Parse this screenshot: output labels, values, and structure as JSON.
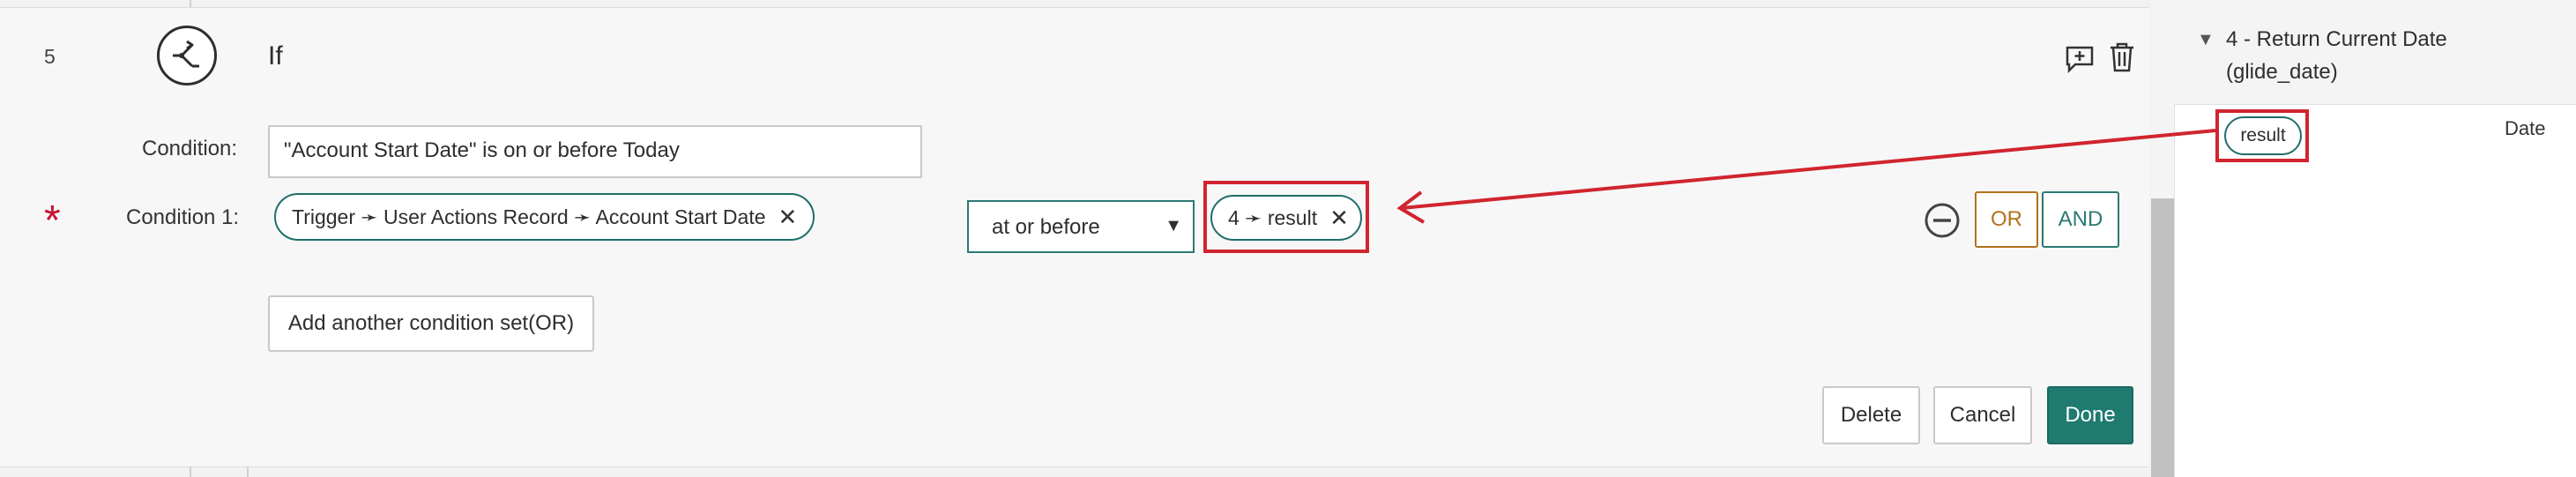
{
  "step": {
    "number": "5",
    "title": "If"
  },
  "condition": {
    "label": "Condition:",
    "value": "\"Account Start Date\" is on or before Today"
  },
  "condition1": {
    "required_mark": "*",
    "label": "Condition 1:",
    "left_pill": "Trigger ➛ User Actions Record ➛ Account Start Date",
    "operator": "at or before",
    "right_pill": "4 ➛ result",
    "remove_glyph": "✕"
  },
  "buttons": {
    "or": "OR",
    "and": "AND",
    "add_condition_set": "Add another condition set(OR)",
    "delete": "Delete",
    "cancel": "Cancel",
    "done": "Done"
  },
  "data_panel": {
    "item_title": "4 - Return Current Date (glide_date)",
    "pill": "result",
    "type": "Date"
  },
  "colors": {
    "accent": "#1f7a6f",
    "highlight": "#d0252f",
    "or": "#b5711b",
    "required": "#c8102e"
  },
  "icons": [
    "branch-icon",
    "add-comment-icon",
    "trash-icon",
    "minus-circle-icon",
    "caret-down-icon",
    "triangle-down-icon",
    "close-icon"
  ]
}
